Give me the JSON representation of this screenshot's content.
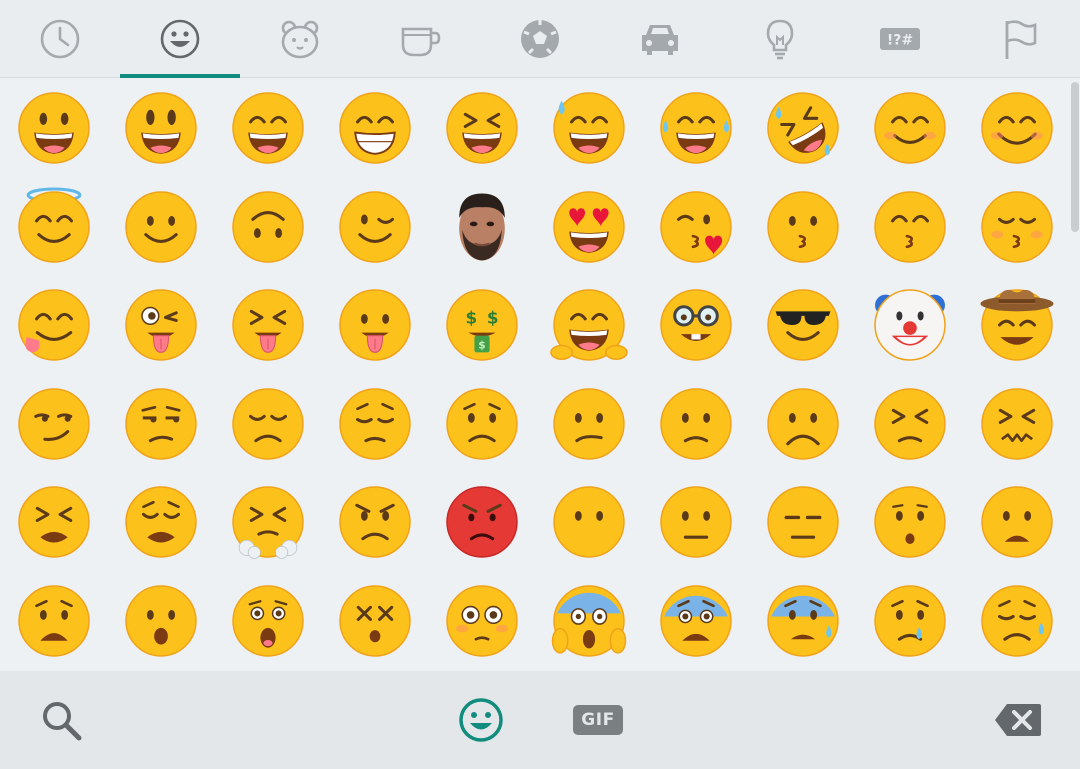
{
  "tabs": [
    {
      "id": "recent",
      "icon": "clock-icon",
      "active": false
    },
    {
      "id": "smileys",
      "icon": "smiley-icon",
      "active": true
    },
    {
      "id": "animals",
      "icon": "bear-icon",
      "active": false
    },
    {
      "id": "food",
      "icon": "cup-icon",
      "active": false
    },
    {
      "id": "activities",
      "icon": "soccer-ball-icon",
      "active": false
    },
    {
      "id": "travel",
      "icon": "car-icon",
      "active": false
    },
    {
      "id": "objects",
      "icon": "lightbulb-icon",
      "active": false
    },
    {
      "id": "symbols",
      "icon": "symbols-icon",
      "label": "!?#",
      "active": false
    },
    {
      "id": "flags",
      "icon": "flag-icon",
      "active": false
    }
  ],
  "emojis": [
    "grinning-face",
    "grinning-face-big-eyes",
    "grinning-face-smiling-eyes",
    "beaming-face",
    "grinning-squinting-face",
    "grinning-face-sweat",
    "face-tears-of-joy",
    "rolling-on-floor-laughing",
    "smiling-face",
    "smiling-face-smiling-eyes",
    "smiling-face-halo",
    "slightly-smiling-face",
    "upside-down-face",
    "winking-face",
    "custom-photo-sticker",
    "smiling-face-heart-eyes",
    "face-blowing-kiss",
    "kissing-face",
    "kissing-face-smiling-eyes",
    "kissing-face-closed-eyes",
    "face-savoring-food",
    "winking-face-tongue",
    "squinting-face-tongue",
    "face-with-tongue",
    "money-mouth-face",
    "hugging-face",
    "nerd-face",
    "smiling-face-sunglasses",
    "clown-face",
    "cowboy-hat-face",
    "smirking-face",
    "unamused-face",
    "disappointed-face",
    "pensive-face",
    "worried-face",
    "confused-face",
    "slightly-frowning-face",
    "frowning-face",
    "persevering-face",
    "confounded-face",
    "tired-face",
    "weary-face",
    "face-steam-from-nose",
    "angry-face",
    "pouting-face",
    "face-without-mouth",
    "neutral-face",
    "expressionless-face",
    "hushed-face",
    "frowning-face-open-mouth",
    "anguished-face",
    "face-open-mouth",
    "astonished-face",
    "dizzy-face",
    "flushed-face",
    "face-screaming-in-fear",
    "fearful-face",
    "anxious-face-sweat",
    "crying-face",
    "sad-but-relieved-face"
  ],
  "colors": {
    "accent": "#128c7e",
    "icon": "#a3a9ac",
    "face": "#fcc21b",
    "face_edge": "#f0a31a"
  },
  "bottom": {
    "search_icon": "search-icon",
    "emoji_icon": "smiley-icon",
    "gif_label": "GIF",
    "backspace_icon": "backspace-icon"
  }
}
